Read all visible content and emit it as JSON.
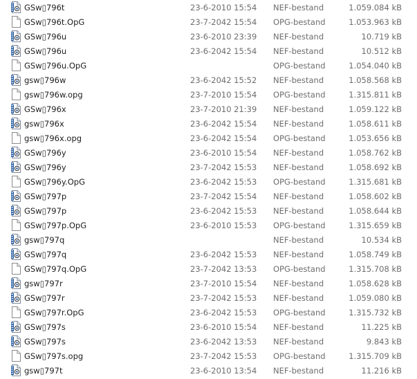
{
  "files": [
    {
      "name": "GSw▯796t",
      "date": "23-6-2010 15:54",
      "type": "NEF-bestand",
      "size": "1.059.084 kB",
      "icon": "nef-image-file-icon"
    },
    {
      "name": "GSw▯796t.OpG",
      "date": "23-7-2042 15:54",
      "type": "OPG-bestand",
      "size": "1.053.963 kB",
      "icon": "blank-file-icon"
    },
    {
      "name": "GSw▯796u",
      "date": "23-6-2010 23:39",
      "type": "NEF-bestand",
      "size": "10.719 kB",
      "icon": "nef-image-file-icon"
    },
    {
      "name": "GSw▯796u",
      "date": "23-6-2042 15:54",
      "type": "NEF-bestand",
      "size": "10.512 kB",
      "icon": "nef-image-file-icon"
    },
    {
      "name": "GSw▯796u.OpG",
      "date": "",
      "type": "OPG-bestand",
      "size": "1.054.040 kB",
      "icon": "blank-file-icon"
    },
    {
      "name": "gsw▯796w",
      "date": "23-6-2042 15:52",
      "type": "NEF-bestand",
      "size": "1.058.568 kB",
      "icon": "nef-image-file-icon"
    },
    {
      "name": "gsw▯796w.opg",
      "date": "23-7-2010 15:54",
      "type": "OPG-bestand",
      "size": "1.315.811 kB",
      "icon": "blank-file-icon"
    },
    {
      "name": "GSw▯796x",
      "date": "23-7-2010 21:39",
      "type": "NEF-bestand",
      "size": "1.059.122 kB",
      "icon": "nef-image-file-icon"
    },
    {
      "name": "gsw▯796x",
      "date": "23-6-2042 15:54",
      "type": "NEF-bestand",
      "size": "1.058.611 kB",
      "icon": "nef-image-file-icon"
    },
    {
      "name": "gsw▯796x.opg",
      "date": "23-6-2042 15:54",
      "type": "OPG-bestand",
      "size": "1.053.656 kB",
      "icon": "blank-file-icon"
    },
    {
      "name": "GSw▯796y",
      "date": "23-6-2010 15:54",
      "type": "NEF-bestand",
      "size": "1.058.762 kB",
      "icon": "nef-image-file-icon"
    },
    {
      "name": "GSw▯796y",
      "date": "23-7-2042 15:53",
      "type": "NEF-bestand",
      "size": "1.058.692 kB",
      "icon": "nef-image-file-icon"
    },
    {
      "name": "GSw▯796y.OpG",
      "date": "23-6-2042 15:53",
      "type": "OPG-bestand",
      "size": "1.315.681 kB",
      "icon": "blank-file-icon"
    },
    {
      "name": "GSw▯797p",
      "date": "23-7-2042 15:54",
      "type": "NEF-bestand",
      "size": "1.058.602 kB",
      "icon": "nef-image-file-icon"
    },
    {
      "name": "GSw▯797p",
      "date": "23-6-2042 15:53",
      "type": "NEF-bestand",
      "size": "1.058.644 kB",
      "icon": "nef-image-file-icon"
    },
    {
      "name": "GSw▯797p.OpG",
      "date": "23-6-2010 15:53",
      "type": "OPG-bestand",
      "size": "1.315.659 kB",
      "icon": "blank-file-icon"
    },
    {
      "name": "gsw▯797q",
      "date": "",
      "type": "NEF-bestand",
      "size": "10.534 kB",
      "icon": "nef-image-file-icon"
    },
    {
      "name": "GSw▯797q",
      "date": "23-6-2042 15:53",
      "type": "NEF-bestand",
      "size": "1.058.749 kB",
      "icon": "nef-image-file-icon"
    },
    {
      "name": "GSw▯797q.OpG",
      "date": "23-7-2042 13:53",
      "type": "OPG-bestand",
      "size": "1.315.708 kB",
      "icon": "blank-file-icon"
    },
    {
      "name": "gsw▯797r",
      "date": "23-7-2010 15:54",
      "type": "NEF-bestand",
      "size": "1.058.628 kB",
      "icon": "nef-image-file-icon"
    },
    {
      "name": "GSw▯797r",
      "date": "23-7-2042 15:53",
      "type": "NEF-bestand",
      "size": "1.059.080 kB",
      "icon": "nef-image-file-icon"
    },
    {
      "name": "GSw▯797r.OpG",
      "date": "23-6-2042 15:53",
      "type": "OPG-bestand",
      "size": "1.315.732 kB",
      "icon": "blank-file-icon"
    },
    {
      "name": "GSw▯797s",
      "date": "23-6-2010 15:54",
      "type": "NEF-bestand",
      "size": "11.225 kB",
      "icon": "nef-image-file-icon"
    },
    {
      "name": "GSw▯797s",
      "date": "23-6-2042 13:53",
      "type": "NEF-bestand",
      "size": "9.843 kB",
      "icon": "nef-image-file-icon"
    },
    {
      "name": "GSw▯797s.opg",
      "date": "23-7-2042 15:53",
      "type": "OPG-bestand",
      "size": "1.315.709 kB",
      "icon": "blank-file-icon"
    },
    {
      "name": "gsw▯797t",
      "date": "23-6-2010 13:54",
      "type": "NEF-bestand",
      "size": "11.216 kB",
      "icon": "nef-image-file-icon"
    }
  ],
  "colors": {
    "background": "#ffffff",
    "name_text": "#1e1e1e",
    "detail_text": "#6d6d6d",
    "nef_icon_accent": "#2a5d9f"
  }
}
